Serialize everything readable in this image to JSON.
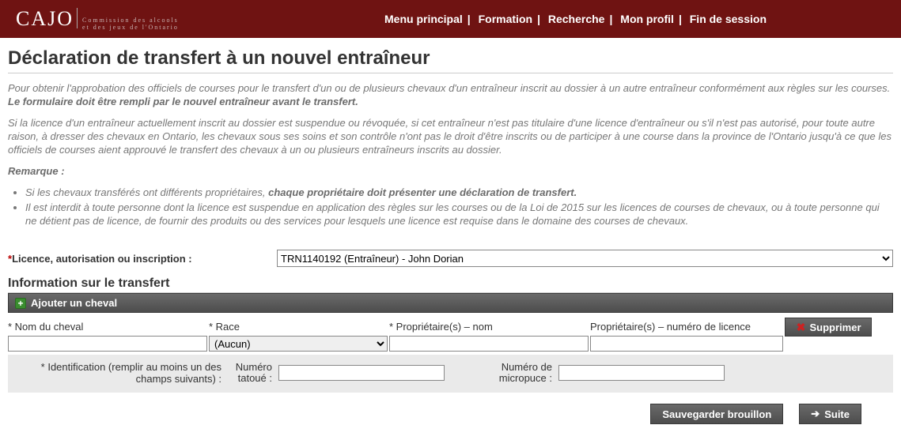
{
  "logo": {
    "text": "CAJO",
    "sub1": "Commission des alcools",
    "sub2": "et des jeux de l'Ontario"
  },
  "nav": {
    "main": "Menu principal",
    "training": "Formation",
    "search": "Recherche",
    "profile": "Mon profil",
    "logout": "Fin de session"
  },
  "page": {
    "title": "Déclaration de transfert à un nouvel entraîneur",
    "intro1a": "Pour obtenir l'approbation des officiels de courses pour le transfert d'un ou de plusieurs chevaux d'un entraîneur inscrit au dossier à un autre entraîneur conformément aux règles sur les courses. ",
    "intro1b": "Le formulaire doit être rempli par le nouvel entraîneur avant le transfert.",
    "intro2": "Si la licence d'un entraîneur actuellement inscrit au dossier est suspendue ou révoquée, si cet entraîneur n'est pas titulaire d'une licence d'entraîneur ou s'il n'est pas autorisé, pour toute autre raison, à dresser des chevaux en Ontario, les chevaux sous ses soins et son contrôle n'ont pas le droit d'être inscrits ou de participer à une course dans la province de l'Ontario jusqu'à ce que les officiels de courses aient approuvé le transfert des chevaux à un ou plusieurs entraîneurs inscrits au dossier.",
    "note_label": "Remarque :",
    "note1a": "Si les chevaux transférés ont différents propriétaires, ",
    "note1b": "chaque propriétaire doit présenter une déclaration de transfert.",
    "note2": "Il est interdit à toute personne dont la licence est suspendue en application des règles sur les courses ou de la Loi de 2015 sur les licences de courses de chevaux, ou à toute personne qui ne détient pas de licence, de fournir des produits ou des services pour lesquels une licence est requise dans le domaine des courses de chevaux."
  },
  "form": {
    "licence_label": "Licence, autorisation ou inscription :",
    "licence_value": "TRN1140192 (Entraîneur) - John Dorian",
    "section_title": "Information sur le transfert",
    "add_horse": "Ajouter un cheval",
    "cols": {
      "name": "* Nom du cheval",
      "breed": "* Race",
      "owner_name": "* Propriétaire(s) – nom",
      "owner_lic": "Propriétaire(s) – numéro de licence"
    },
    "breed_none": "(Aucun)",
    "delete": "Supprimer",
    "id_label": "* Identification (remplir au moins un des champs suivants) :",
    "tattoo_lbl": "Numéro tatoué :",
    "chip_lbl": "Numéro de micropuce :",
    "save_draft": "Sauvegarder brouillon",
    "next": "Suite"
  }
}
